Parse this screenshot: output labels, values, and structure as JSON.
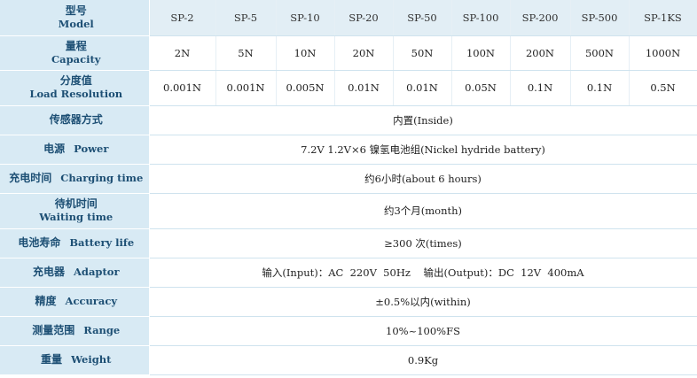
{
  "header": {
    "label_zh": "型号",
    "label_en": "Model",
    "models": [
      "SP-2",
      "SP-5",
      "SP-10",
      "SP-20",
      "SP-50",
      "SP-100",
      "SP-200",
      "SP-500",
      "SP-1KS"
    ]
  },
  "capacity": {
    "label_zh": "量程",
    "label_en": "Capacity",
    "values": [
      "2N",
      "5N",
      "10N",
      "20N",
      "50N",
      "100N",
      "200N",
      "500N",
      "1000N"
    ]
  },
  "resolution": {
    "label_zh": "分度值",
    "label_en": "Load Resolution",
    "values": [
      "0.001N",
      "0.001N",
      "0.005N",
      "0.01N",
      "0.01N",
      "0.05N",
      "0.1N",
      "0.1N",
      "0.5N"
    ]
  },
  "rows": [
    {
      "label_zh": "传感器方式",
      "label_en": "",
      "value": "内置(Inside)"
    },
    {
      "label_zh": "电源",
      "label_en": "Power",
      "value": "7.2V  1.2V×6 镍氢电池组(Nickel hydride battery)"
    },
    {
      "label_zh": "充电时间",
      "label_en": "Charging time",
      "value": "约6小时(about 6 hours)"
    },
    {
      "label_zh": "待机时间",
      "label_en": "Waiting time",
      "value": "约3个月(month)"
    },
    {
      "label_zh": "电池寿命",
      "label_en": "Battery life",
      "value": "≥300 次(times)"
    },
    {
      "label_zh": "充电器",
      "label_en": "Adaptor",
      "value": "输入(Input)：AC  220V  50Hz    输出(Output)：DC  12V  400mA"
    },
    {
      "label_zh": "精度",
      "label_en": "Accuracy",
      "value": "±0.5%以内(within)"
    },
    {
      "label_zh": "测量范围",
      "label_en": "Range",
      "value": "10%~100%FS"
    },
    {
      "label_zh": "重量",
      "label_en": "Weight",
      "value": "0.9Kg"
    }
  ]
}
